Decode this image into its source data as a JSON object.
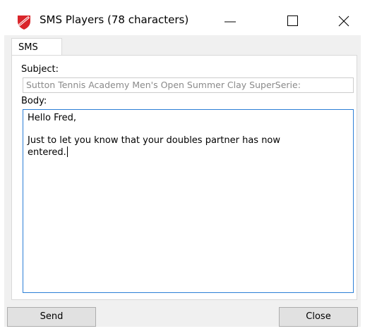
{
  "window": {
    "title": "SMS Players (78 characters)",
    "icon": "shield-logo-icon",
    "controls": [
      "minimize-icon",
      "maximize-icon",
      "close-icon"
    ]
  },
  "tabs": [
    {
      "label": "SMS",
      "selected": true
    }
  ],
  "form": {
    "subject_label": "Subject:",
    "subject_value": "Sutton Tennis Academy Men's Open Summer Clay SuperSerie:",
    "body_label": "Body:",
    "body_lines": [
      "Hello Fred,",
      "",
      "Just to let you know that your doubles partner has now",
      "entered."
    ]
  },
  "buttons": {
    "send_label": "Send",
    "close_label": "Close"
  },
  "colors": {
    "accent_border": "#2c7fd6",
    "dialog_bg": "#f0f0f0",
    "icon_red": "#d9252a"
  }
}
